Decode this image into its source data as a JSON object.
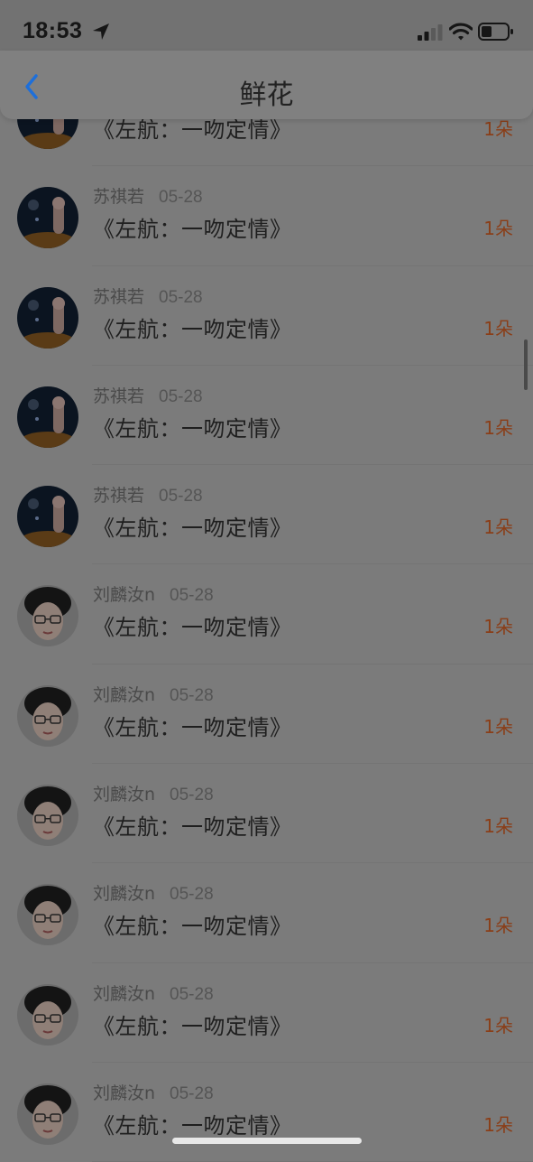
{
  "status_bar": {
    "time": "18:53"
  },
  "header": {
    "title": "鲜花"
  },
  "gift_list": [
    {
      "user": "",
      "date": "",
      "book": "《左航：一吻定情》",
      "count": "1朵",
      "avatar": "astronaut-bear-avatar"
    },
    {
      "user": "苏祺若",
      "date": "05-28",
      "book": "《左航：一吻定情》",
      "count": "1朵",
      "avatar": "astronaut-bear-avatar"
    },
    {
      "user": "苏祺若",
      "date": "05-28",
      "book": "《左航：一吻定情》",
      "count": "1朵",
      "avatar": "astronaut-bear-avatar"
    },
    {
      "user": "苏祺若",
      "date": "05-28",
      "book": "《左航：一吻定情》",
      "count": "1朵",
      "avatar": "astronaut-bear-avatar"
    },
    {
      "user": "苏祺若",
      "date": "05-28",
      "book": "《左航：一吻定情》",
      "count": "1朵",
      "avatar": "astronaut-bear-avatar"
    },
    {
      "user": "刘麟汝n",
      "date": "05-28",
      "book": "《左航：一吻定情》",
      "count": "1朵",
      "avatar": "glasses-boy-avatar"
    },
    {
      "user": "刘麟汝n",
      "date": "05-28",
      "book": "《左航：一吻定情》",
      "count": "1朵",
      "avatar": "glasses-boy-avatar"
    },
    {
      "user": "刘麟汝n",
      "date": "05-28",
      "book": "《左航：一吻定情》",
      "count": "1朵",
      "avatar": "glasses-boy-avatar"
    },
    {
      "user": "刘麟汝n",
      "date": "05-28",
      "book": "《左航：一吻定情》",
      "count": "1朵",
      "avatar": "glasses-boy-avatar"
    },
    {
      "user": "刘麟汝n",
      "date": "05-28",
      "book": "《左航：一吻定情》",
      "count": "1朵",
      "avatar": "glasses-boy-avatar"
    },
    {
      "user": "刘麟汝n",
      "date": "05-28",
      "book": "《左航：一吻定情》",
      "count": "1朵",
      "avatar": "glasses-boy-avatar"
    }
  ],
  "colors": {
    "accent": "#1e6fd9",
    "count": "#8a3e18",
    "overlay": "#7b7b7b"
  }
}
